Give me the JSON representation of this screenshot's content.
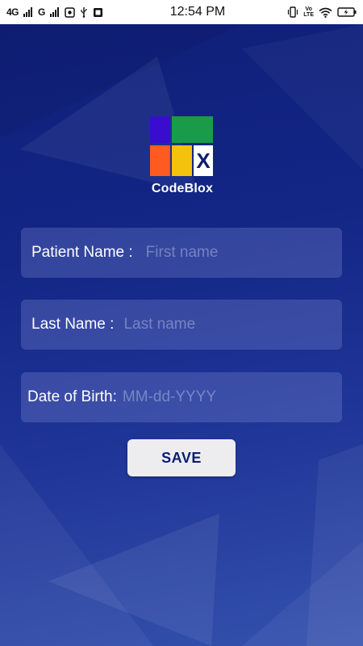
{
  "status_bar": {
    "network1": "4G",
    "network2": "G",
    "time": "12:54 PM",
    "volte_line1": "Vo",
    "volte_line2": "LTE",
    "icons_left": [
      "signal-icon",
      "signal-icon",
      "screenshot-icon",
      "usb-icon",
      "notification-icon"
    ],
    "icons_right": [
      "vibrate-icon",
      "volte-icon",
      "wifi-icon",
      "battery-icon"
    ]
  },
  "app": {
    "logo_text": "CodeBlox",
    "logo_letter": "X",
    "logo_colors": {
      "purple": "#3a0ccf",
      "green": "#1a9b4a",
      "orange": "#ff5a1f",
      "yellow": "#f4c20d",
      "white": "#ffffff",
      "x_color": "#0d1d6e"
    },
    "fields": {
      "patient_name": {
        "label": "Patient Name :",
        "placeholder": "First name",
        "value": ""
      },
      "last_name": {
        "label": "Last Name :",
        "placeholder": "Last name",
        "value": ""
      },
      "dob": {
        "label": "Date of Birth:",
        "placeholder": "MM-dd-YYYY",
        "value": ""
      }
    },
    "save_label": "SAVE"
  },
  "colors": {
    "background_top": "#0f1f78",
    "background_bottom": "#3451ad",
    "button_bg": "#ededf0",
    "button_text": "#0d1d6e",
    "caret": "#17b8a0"
  }
}
